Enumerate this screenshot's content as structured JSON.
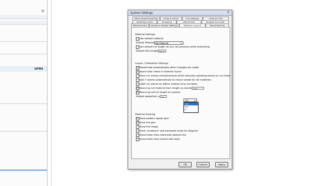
{
  "background_app": {
    "selected_row": "ures",
    "close_glyph": "×"
  },
  "dialog": {
    "title": "System Settings",
    "close_glyph": "×",
    "tabs_row1": [
      "Other Sheet Properties",
      "Fonts & Colors",
      "Line Settings",
      "Units and Tex"
    ],
    "tabs_row2": [
      "Reading Lumen",
      "Grouping",
      "Title Frame",
      "Student Accounts"
    ],
    "tabs_row3": [
      "Measurement",
      "Classes & Design Settings",
      "Material / Layout",
      "Sheet Naming"
    ],
    "material_settings": {
      "header": "Material Settings",
      "use_default": "Use default material",
      "default_material_label": "Default Material",
      "default_material_value": "No Material",
      "default_roll": "Use default roll length for ALL roll products while estimating",
      "roll_length_label": "Default Roll Length",
      "roll_length_value": "84.0"
    },
    "layout": {
      "header": "Layout / Estimation Settings",
      "items": [
        {
          "label": "Reestimate automatically when changes are made",
          "checked": true
        },
        {
          "label": "Ignore door areas in material layout",
          "checked": true
        },
        {
          "label": "Move cut arrows simultaneously while manually adjusting pieces on cut sheet",
          "checked": false
        },
        {
          "label": "Add 'l' seams automatically to reduce waste for roll materials",
          "checked": false
        },
        {
          "label": "Label cut pieces by letters instead of by numbers",
          "checked": false
        }
      ],
      "round_up_label": "Round up roll material from length to nearest",
      "round_up_value": "1/2\"",
      "round_up_checked": true,
      "round_up_cut_label": "Round up roll cut length to nearest",
      "round_up_cut_value": "1/4",
      "round_up_cut_checked": true,
      "default_pct_label": "Default waste/trim pcs",
      "default_pct_value": "10",
      "dropdown_options": [
        "1/4",
        "1/2",
        "1\"",
        "2\""
      ]
    },
    "drawing": {
      "header": "Material Drawing",
      "items": [
        {
          "label": "Show pattern repeat grid",
          "checked": true
        },
        {
          "label": "Show the grid",
          "checked": true
        },
        {
          "label": "Show the image",
          "checked": false
        },
        {
          "label": "Show 'renderout' and borrowed photo for diagram",
          "checked": false
        },
        {
          "label": "Show these lines inked with dashed line",
          "checked": false
        },
        {
          "label": "Show these lines inward with label",
          "checked": false
        }
      ]
    },
    "buttons": {
      "ok": "OK",
      "cancel": "Cancel",
      "apply": "Apply"
    }
  }
}
